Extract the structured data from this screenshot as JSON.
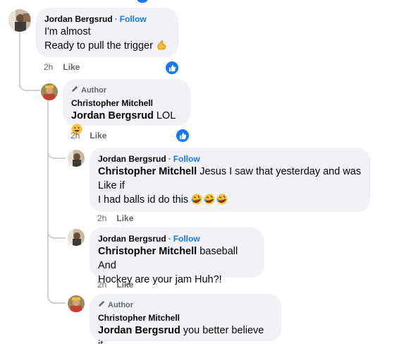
{
  "comments": [
    {
      "author": "Jordan Bergsrud",
      "follow_label": "Follow",
      "line1": "I'm almost",
      "line2": "Ready to pull the trigger",
      "emoji": "muscle-emoji",
      "time": "2h",
      "like_label": "Like",
      "reaction": "like-reaction"
    },
    {
      "author_tag": "Author",
      "author": "Christopher Mitchell",
      "mention": "Jordan Bergsrud",
      "text": " LOL",
      "emoji": "grinning-emoji",
      "time": "2h",
      "like_label": "Like",
      "reaction": "like-reaction"
    },
    {
      "author": "Jordan Bergsrud",
      "follow_label": "Follow",
      "mention": "Christopher Mitchell",
      "text1": " Jesus I saw that yesterday and was",
      "text2": "Like if",
      "text3": "I had balls id do this ",
      "emoji": "rolling-on-floor-laughing-emoji x3",
      "time": "2h",
      "like_label": "Like"
    },
    {
      "author": "Jordan Bergsrud",
      "follow_label": "Follow",
      "mention": "Christopher Mitchell",
      "text1": " baseball And",
      "text2": "Hockey are your jam Huh?!",
      "time": "2h",
      "like_label": "Like"
    },
    {
      "author_tag": "Author",
      "author": "Christopher Mitchell",
      "mention": "Jordan Bergsrud",
      "text": " you better believe it."
    }
  ],
  "colors": {
    "bubble": "#f0f2f5",
    "accent": "#1877f2",
    "meta": "#65676b",
    "thread": "#ced0d4"
  }
}
